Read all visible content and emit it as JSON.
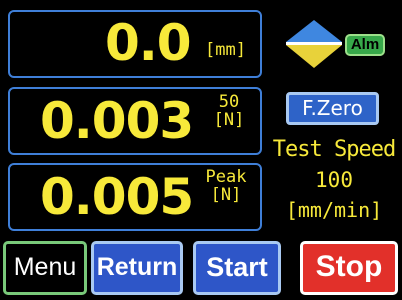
{
  "display": {
    "position_value": "0.0",
    "position_unit": "[mm]",
    "force_value": "0.003",
    "force_top_label": "50",
    "force_unit": "[N]",
    "peak_value": "0.005",
    "peak_label": "Peak",
    "peak_unit": "[N]"
  },
  "status": {
    "alarm_label": "Alm"
  },
  "controls": {
    "fzero_label": "F.Zero"
  },
  "test_speed": {
    "label": "Test Speed",
    "value": "100",
    "unit": "[mm/min]"
  },
  "buttons": {
    "menu": "Menu",
    "return": "Return",
    "start": "Start",
    "stop": "Stop"
  },
  "icons": {
    "direction": "up-down-arrow-icon"
  },
  "colors": {
    "value_yellow": "#f7e93a",
    "panel_border": "#3f7fd8",
    "button_blue": "#2e56c8",
    "stop_red": "#e2302a",
    "alarm_green": "#37a84a"
  }
}
